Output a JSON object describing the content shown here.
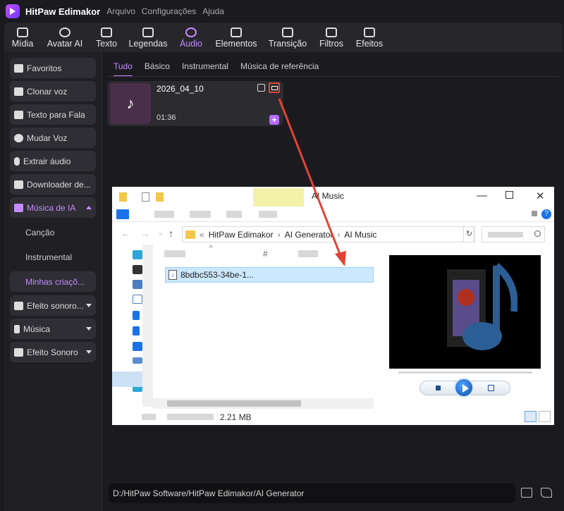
{
  "app": {
    "name": "HitPaw Edimakor",
    "menu": [
      "Arquivo",
      "Configurações",
      "Ajuda"
    ]
  },
  "toolbar": {
    "items": [
      {
        "label": "Mídia",
        "icon": "media-icon"
      },
      {
        "label": "Avatar AI",
        "icon": "avatar-icon"
      },
      {
        "label": "Texto",
        "icon": "text-icon"
      },
      {
        "label": "Legendas",
        "icon": "captions-icon"
      },
      {
        "label": "Áudio",
        "icon": "audio-icon",
        "active": true
      },
      {
        "label": "Elementos",
        "icon": "elements-icon"
      },
      {
        "label": "Transição",
        "icon": "transition-icon"
      },
      {
        "label": "Filtros",
        "icon": "filters-icon"
      },
      {
        "label": "Efeitos",
        "icon": "effects-icon"
      }
    ],
    "accent": "#c58cff"
  },
  "sidebar": {
    "items": [
      {
        "label": "Favoritos",
        "icon": "star-icon"
      },
      {
        "label": "Clonar voz",
        "icon": "waveform-icon"
      },
      {
        "label": "Texto para Fala",
        "icon": "text-to-speech-icon"
      },
      {
        "label": "Mudar Voz",
        "icon": "voice-change-icon"
      },
      {
        "label": "Extrair áudio",
        "icon": "microphone-icon"
      },
      {
        "label": "Downloader de...",
        "icon": "download-icon"
      },
      {
        "label": "Música de IA",
        "icon": "ai-music-icon",
        "expanded": true
      },
      {
        "label": "Efeito sonoro...",
        "icon": "sound-effect-icon"
      },
      {
        "label": "Música",
        "icon": "music-note-icon"
      },
      {
        "label": "Efeito Sonoro",
        "icon": "sound-effect-icon"
      }
    ],
    "sub_items": [
      "Canção",
      "Instrumental",
      "Minhas criaçõ..."
    ]
  },
  "tabs": [
    "Tudo",
    "Básico",
    "Instrumental",
    "Música de referência"
  ],
  "card": {
    "title": "2026_04_10",
    "duration": "01:36",
    "add_label": "+",
    "thumb_icon": "ai-music-note-icon"
  },
  "path": {
    "value": "D:/HitPaw Software/HitPaw Edimakor/AI Generator"
  },
  "explorer": {
    "title": "AI Music",
    "breadcrumb": [
      "«",
      "HitPaw Edimakor",
      "›",
      "AI Generator",
      "›",
      "AI Music"
    ],
    "column_hash": "#",
    "file_name": "8bdbc553-34be-1...",
    "status_size": "2.21 MB"
  },
  "colors": {
    "highlight": "#e04436",
    "accent": "#c58cff"
  }
}
